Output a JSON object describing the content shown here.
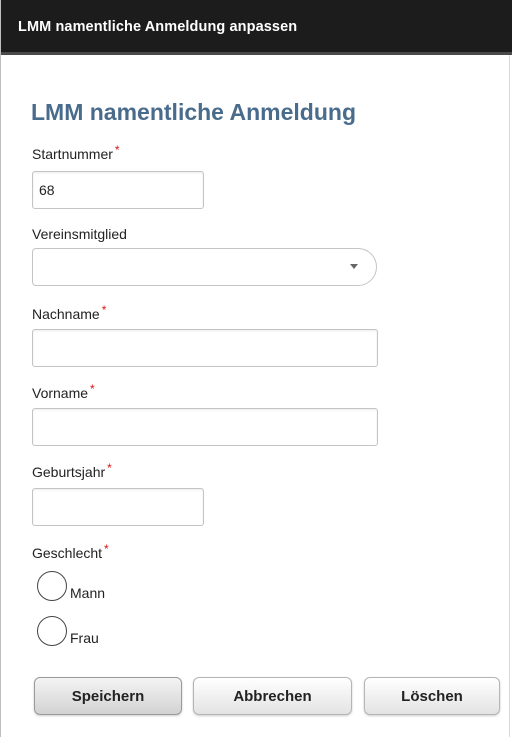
{
  "dialog": {
    "title": "LMM namentliche Anmeldung anpassen"
  },
  "form": {
    "heading": "LMM namentliche Anmeldung",
    "required_marker": "*",
    "startnummer": {
      "label": "Startnummer",
      "value": "68"
    },
    "vereinsmitglied": {
      "label": "Vereinsmitglied",
      "value": ""
    },
    "nachname": {
      "label": "Nachname",
      "value": ""
    },
    "vorname": {
      "label": "Vorname",
      "value": ""
    },
    "geburtsjahr": {
      "label": "Geburtsjahr",
      "value": ""
    },
    "geschlecht": {
      "label": "Geschlecht",
      "options": [
        "Mann",
        "Frau"
      ],
      "selected": null
    }
  },
  "buttons": {
    "save": "Speichern",
    "cancel": "Abbrechen",
    "delete": "Löschen"
  },
  "colors": {
    "titlebar_bg": "#1c1c1c",
    "heading": "#4a6c8c",
    "required": "#dd1111"
  },
  "icons": {
    "select_arrow": "chevron-down-icon",
    "radio": "radio-icon"
  }
}
